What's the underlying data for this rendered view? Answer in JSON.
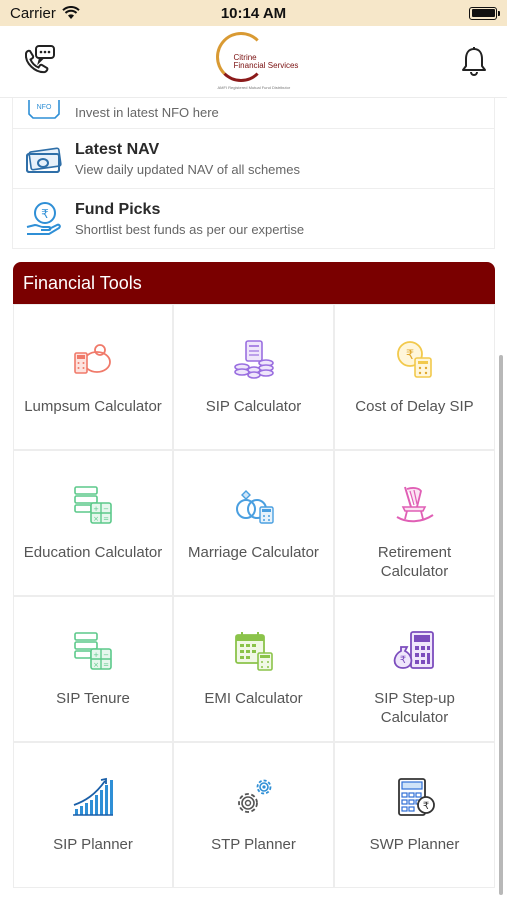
{
  "status_bar": {
    "carrier": "Carrier",
    "time": "10:14 AM"
  },
  "header": {
    "logo": {
      "name": "Citrine Financial Services",
      "line1": "Citrine",
      "line2": "Financial Services",
      "tagline": "AMFI Registered Mutual Fund Distributor"
    }
  },
  "menu": [
    {
      "icon": "nfo-icon",
      "title": "",
      "desc": "Invest in latest NFO here"
    },
    {
      "icon": "money-icon",
      "title": "Latest NAV",
      "desc": "View daily updated NAV of all schemes"
    },
    {
      "icon": "rupee-hand-icon",
      "title": "Fund Picks",
      "desc": "Shortlist best funds as per our expertise"
    }
  ],
  "tools": {
    "title": "Financial Tools",
    "items": [
      {
        "label": "Lumpsum Calculator",
        "icon": "piggy-bank-icon",
        "color": "#f07a6a"
      },
      {
        "label": "SIP Calculator",
        "icon": "coins-stack-icon",
        "color": "#9a6fe0"
      },
      {
        "label": "Cost of Delay SIP",
        "icon": "rupee-coin-calculator-icon",
        "color": "#f2c94c"
      },
      {
        "label": "Education Calculator",
        "icon": "books-calculator-icon",
        "color": "#5cc98a"
      },
      {
        "label": "Marriage Calculator",
        "icon": "rings-calculator-icon",
        "color": "#4a9fe0"
      },
      {
        "label": "Retirement Calculator",
        "icon": "rocking-chair-icon",
        "color": "#e05fb5"
      },
      {
        "label": "SIP Tenure",
        "icon": "books-calculator-icon",
        "color": "#5cc98a"
      },
      {
        "label": "EMI Calculator",
        "icon": "calendar-calculator-icon",
        "color": "#8bc34a"
      },
      {
        "label": "SIP Step-up Calculator",
        "icon": "rupee-bag-calculator-icon",
        "color": "#7c4dbd"
      },
      {
        "label": "SIP Planner",
        "icon": "growth-bars-icon",
        "color": "#2f8fd6"
      },
      {
        "label": "STP Planner",
        "icon": "gears-icon",
        "color": "#555555"
      },
      {
        "label": "SWP Planner",
        "icon": "calculator-rupee-icon",
        "color": "#2f6fd6"
      }
    ]
  }
}
